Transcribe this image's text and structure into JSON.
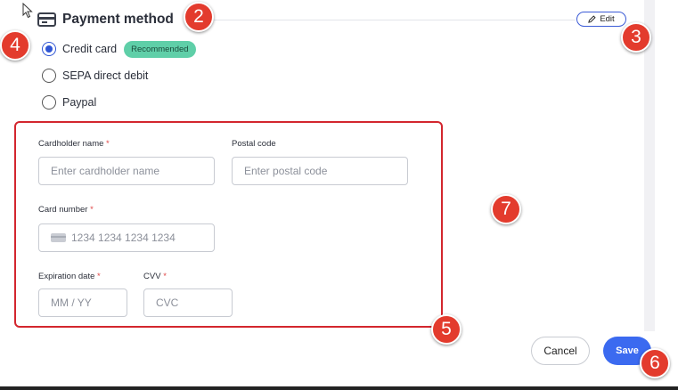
{
  "header": {
    "title": "Payment method",
    "edit_label": "Edit"
  },
  "payment_options": [
    {
      "label": "Credit card",
      "selected": true,
      "badge": "Recommended"
    },
    {
      "label": "SEPA direct debit",
      "selected": false
    },
    {
      "label": "Paypal",
      "selected": false
    }
  ],
  "form": {
    "cardholder": {
      "label": "Cardholder name",
      "required_mark": "*",
      "placeholder": "Enter cardholder name"
    },
    "postal": {
      "label": "Postal code",
      "placeholder": "Enter postal code"
    },
    "card_number": {
      "label": "Card number",
      "required_mark": "*",
      "placeholder": "1234 1234 1234 1234"
    },
    "expiration": {
      "label": "Expiration date",
      "required_mark": "*",
      "placeholder": "MM / YY"
    },
    "cvv": {
      "label": "CVV",
      "required_mark": "*",
      "placeholder": "CVC"
    }
  },
  "actions": {
    "cancel_label": "Cancel",
    "save_label": "Save"
  },
  "markers": [
    "2",
    "3",
    "4",
    "5",
    "6",
    "7"
  ],
  "colors": {
    "accent": "#3b6af0",
    "badge": "#5fcfa8",
    "highlight_border": "#d3262e",
    "marker": "#e33b2d"
  }
}
